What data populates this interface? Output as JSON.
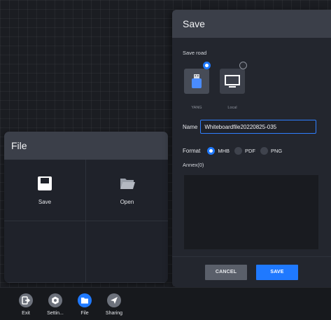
{
  "file_panel": {
    "title": "File",
    "items": [
      {
        "label": "Save",
        "icon": "floppy-disk-icon"
      },
      {
        "label": "Open",
        "icon": "folder-open-icon"
      }
    ]
  },
  "save_dialog": {
    "title": "Save",
    "save_road_label": "Save road",
    "devices": [
      {
        "label": "YANG",
        "icon": "usb-drive-icon",
        "selected": true
      },
      {
        "label": "Local",
        "icon": "monitor-icon",
        "selected": false
      }
    ],
    "name_label": "Name",
    "name_value": "Whiteboardfile20220825-035",
    "format_label": "Format",
    "formats": [
      {
        "label": "MHB",
        "selected": true
      },
      {
        "label": "PDF",
        "selected": false
      },
      {
        "label": "PNG",
        "selected": false
      }
    ],
    "annex_label": "Annex(0)",
    "cancel_label": "CANCEL",
    "save_label": "SAVE"
  },
  "toolbar": {
    "items": [
      {
        "label": "Exit",
        "icon": "exit-icon",
        "active": false
      },
      {
        "label": "Settin...",
        "icon": "gear-icon",
        "active": false
      },
      {
        "label": "File",
        "icon": "folder-icon",
        "active": true
      },
      {
        "label": "Sharing",
        "icon": "send-icon",
        "active": false
      }
    ]
  },
  "colors": {
    "accent": "#1f79ff",
    "panel_header": "#3b3f49",
    "panel_body": "#23262e",
    "canvas": "#1b1d22"
  }
}
